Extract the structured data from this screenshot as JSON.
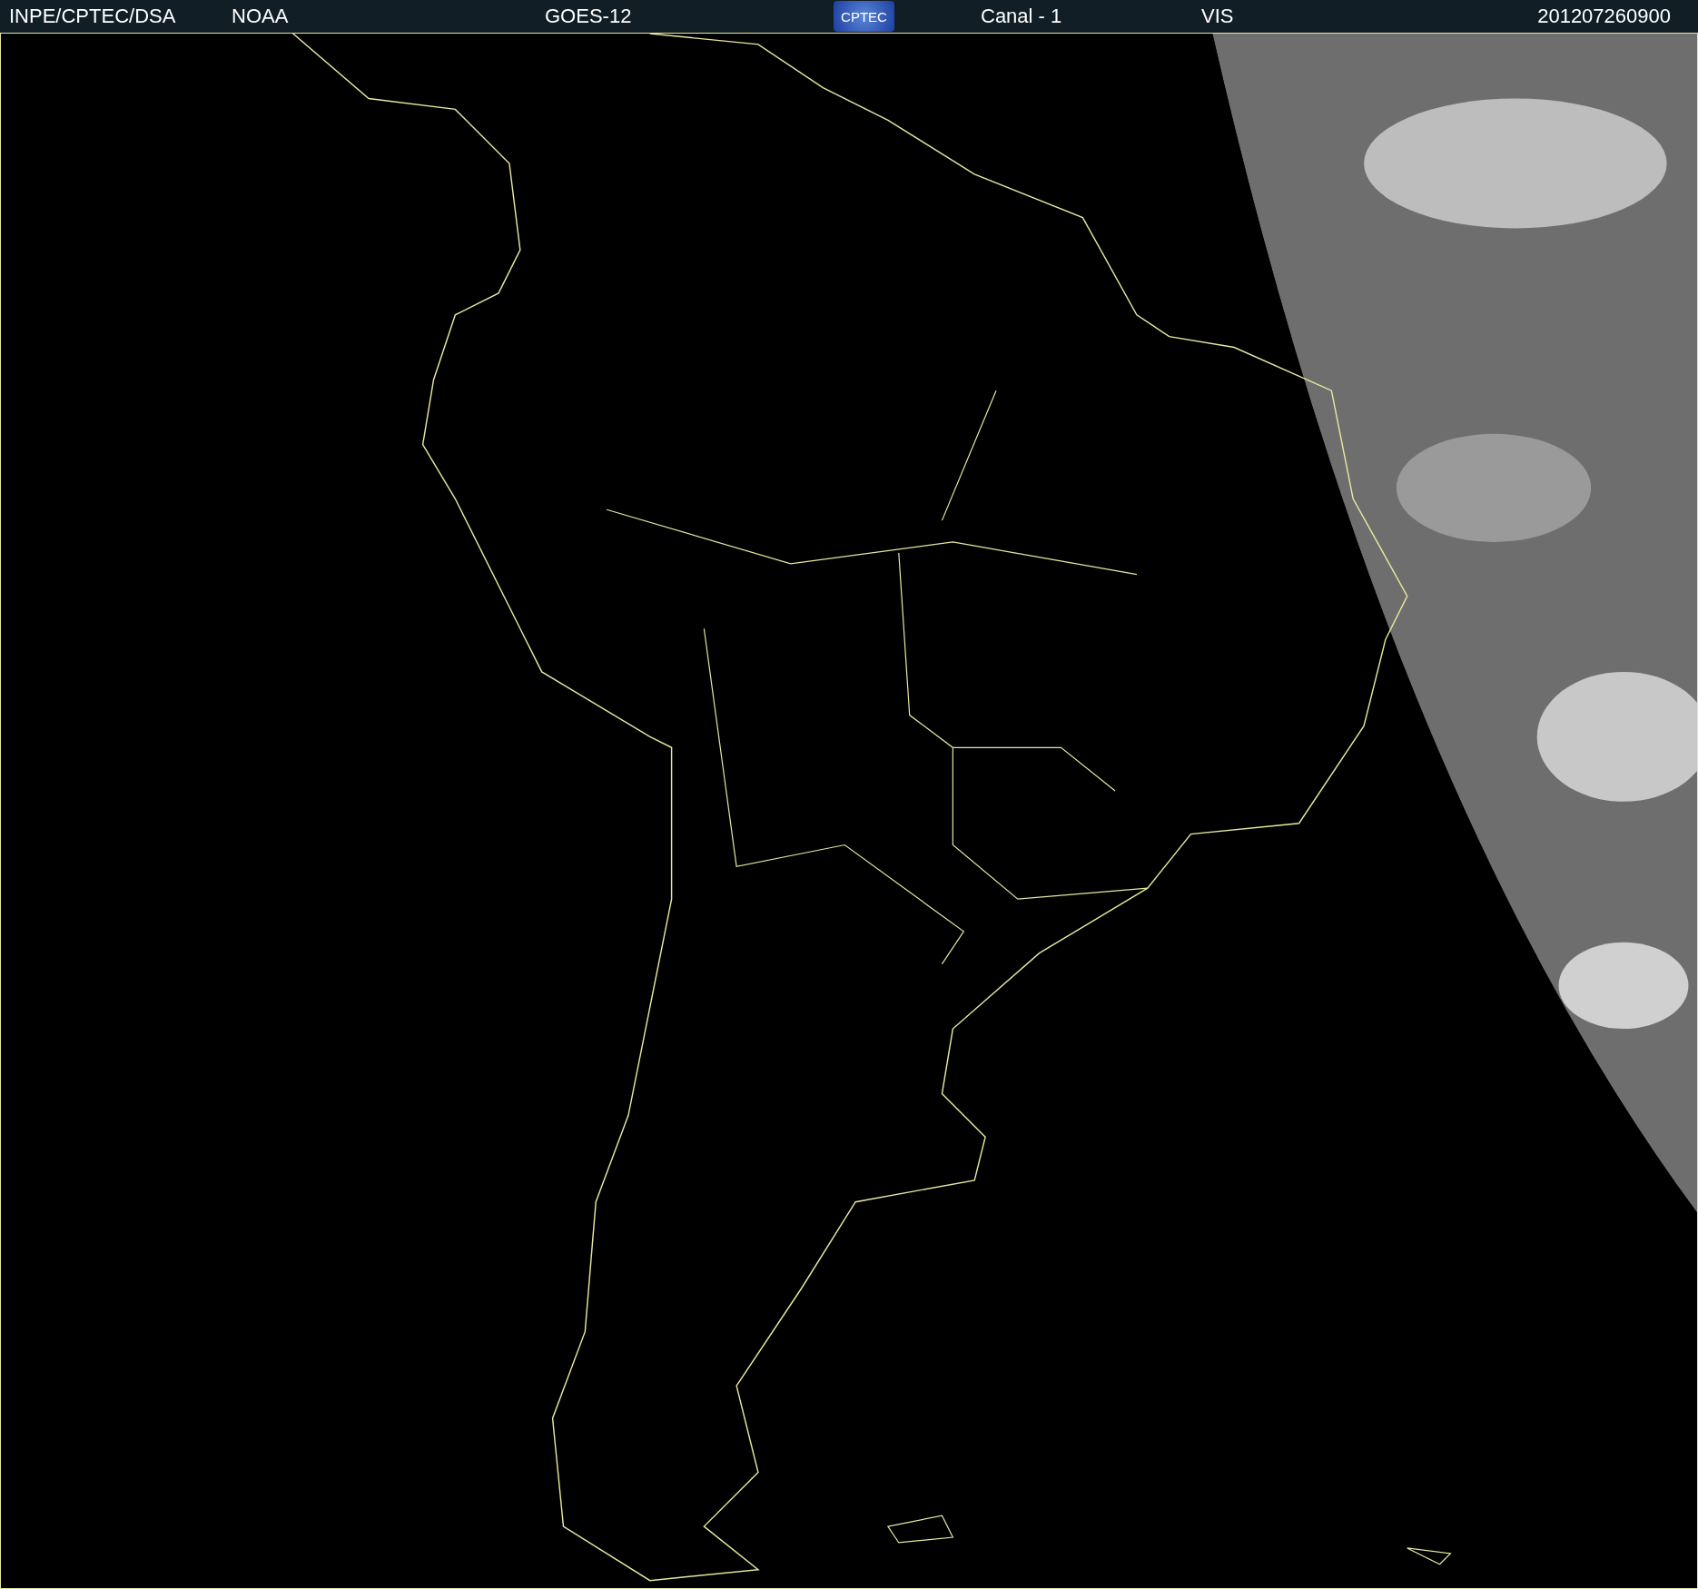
{
  "header": {
    "source": "INPE/CPTEC/DSA",
    "agency": "NOAA",
    "satellite": "GOES-12",
    "logo": "CPTEC",
    "channel": "Canal - 1",
    "band": "VIS",
    "timestamp": "201207260900"
  }
}
